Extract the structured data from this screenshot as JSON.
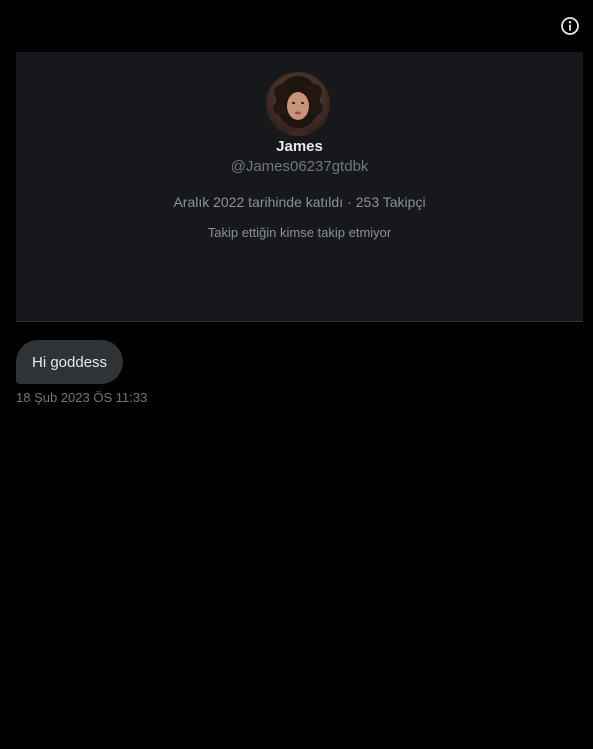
{
  "header": {
    "info_icon": "info-circle-icon"
  },
  "profile": {
    "avatar_icon": "user-avatar",
    "display_name": "James",
    "handle": "@James06237gtdbk",
    "joined": "Aralık 2022 tarihinde katıldı",
    "separator": "·",
    "followers": "253 Takipçi",
    "follow_note": "Takip ettiğin kimse takip etmiyor"
  },
  "messages": [
    {
      "text": "Hi goddess",
      "timestamp": "18 Şub 2023 ÖS 11:33"
    }
  ],
  "colors": {
    "background": "#000000",
    "card": "#16181c",
    "bubble": "#2f3336",
    "primary_text": "#e7e9ea",
    "secondary_text": "#71767b"
  }
}
